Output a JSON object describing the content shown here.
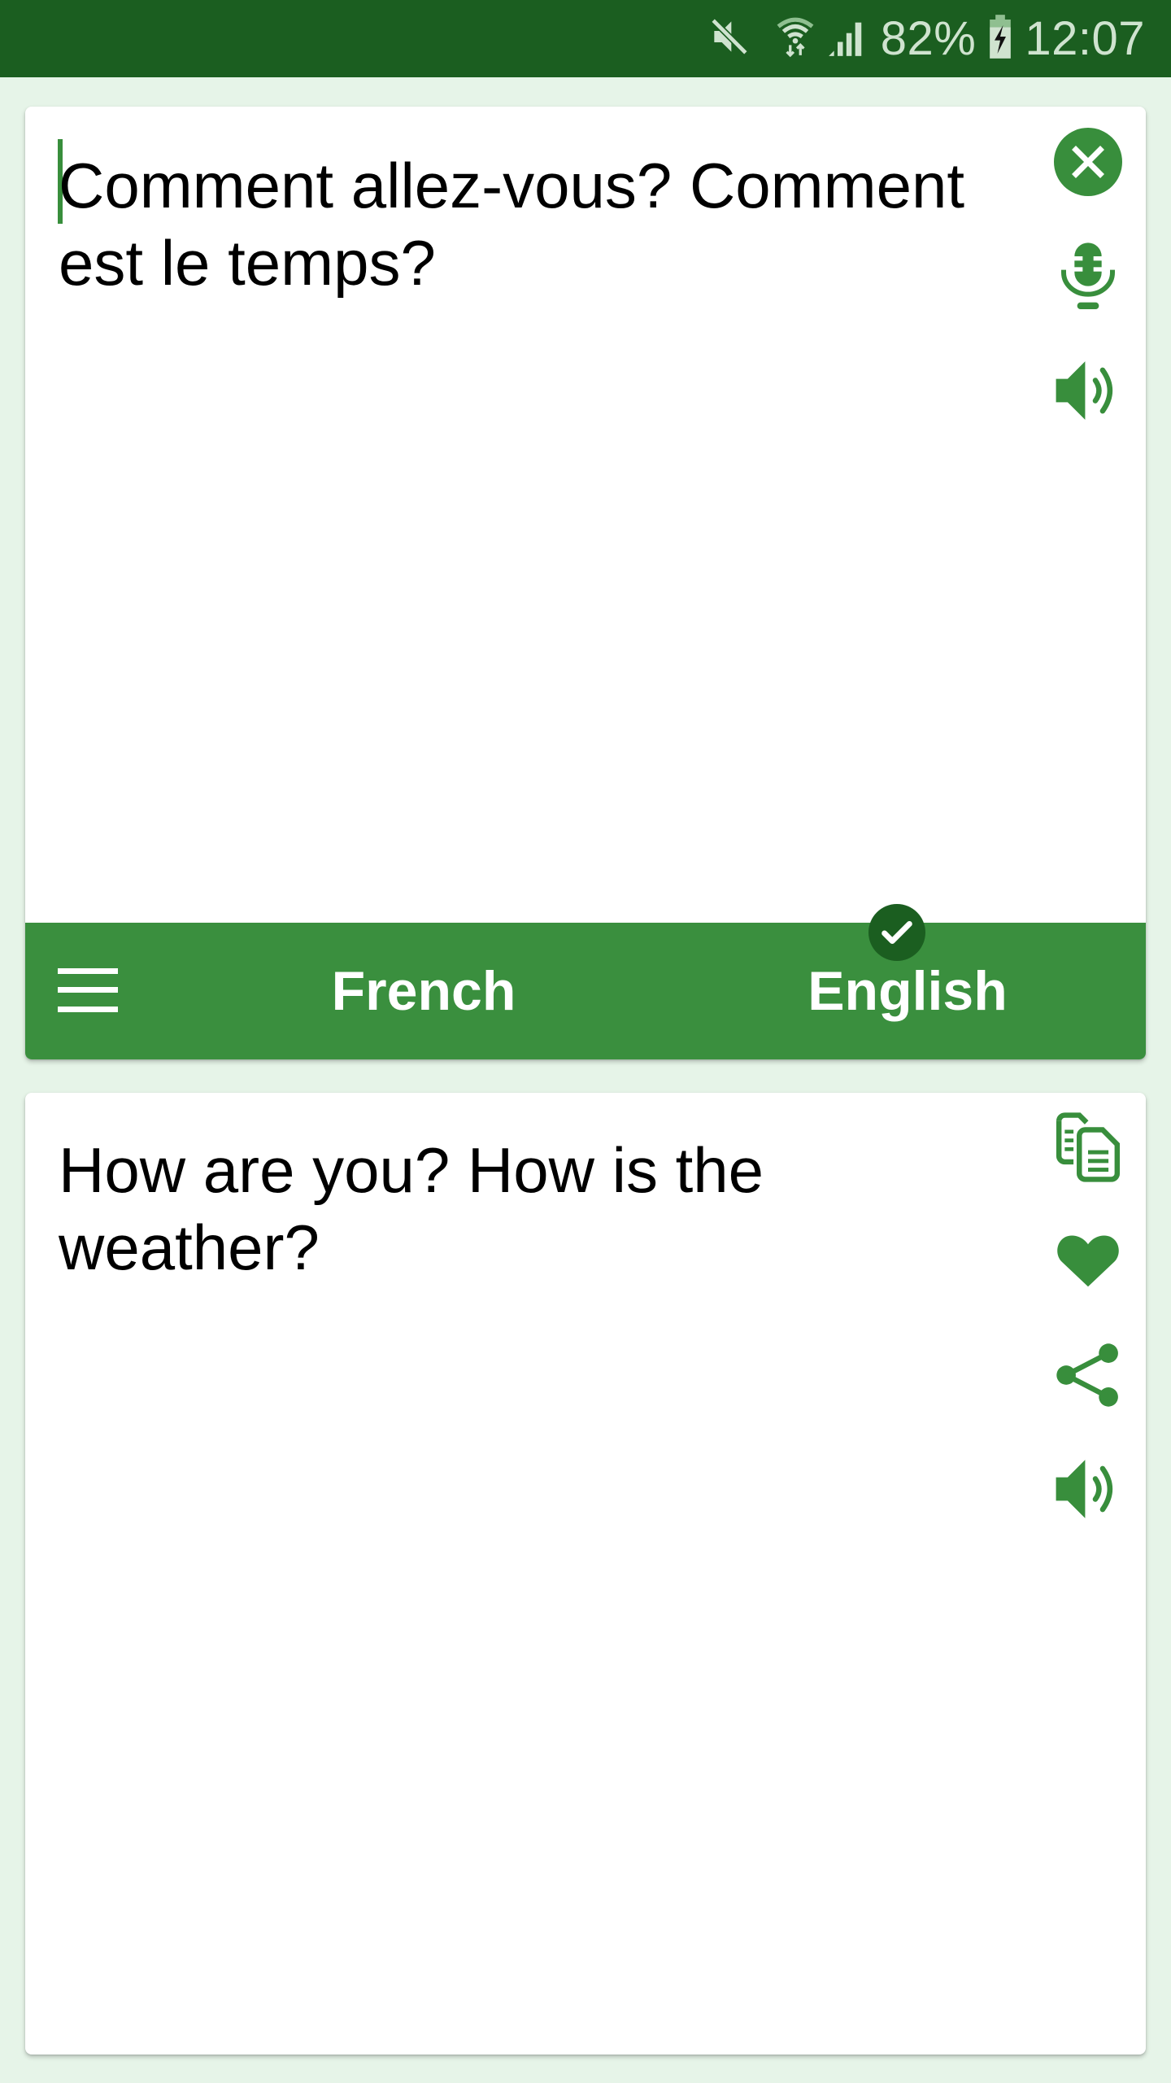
{
  "status_bar": {
    "icons": [
      "mute-icon",
      "wifi-icon",
      "signal-icon",
      "battery-charging-icon"
    ],
    "battery_percent": "82%",
    "time": "12:07"
  },
  "input": {
    "text": "Comment allez-vous? Comment est le temps?",
    "actions": [
      {
        "name": "clear",
        "icon": "close-circle-icon"
      },
      {
        "name": "voice-input",
        "icon": "microphone-icon"
      },
      {
        "name": "speak-input",
        "icon": "speaker-icon"
      }
    ]
  },
  "language_bar": {
    "menu_icon": "hamburger-menu-icon",
    "source_language": "French",
    "target_language": "English",
    "selected_indicator": "check-icon"
  },
  "output": {
    "text": "How are you? How is the weather?",
    "actions": [
      {
        "name": "copy",
        "icon": "copy-icon"
      },
      {
        "name": "favorite",
        "icon": "heart-icon"
      },
      {
        "name": "share",
        "icon": "share-icon"
      },
      {
        "name": "speak-output",
        "icon": "speaker-icon"
      }
    ]
  },
  "colors": {
    "primary_dark": "#1b5e20",
    "primary": "#388e3c",
    "background": "#e6f4e8",
    "card": "#ffffff",
    "text": "#000000"
  }
}
